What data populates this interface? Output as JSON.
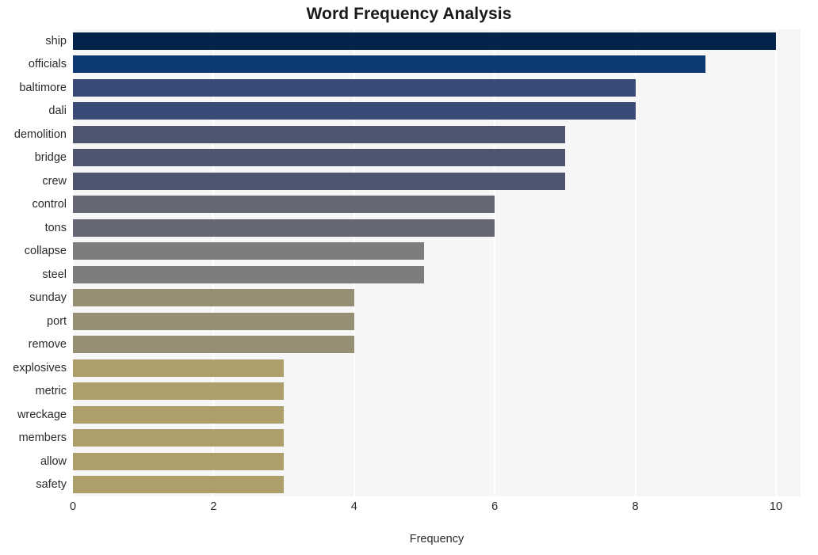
{
  "chart_data": {
    "type": "bar",
    "orientation": "horizontal",
    "title": "Word Frequency Analysis",
    "xlabel": "Frequency",
    "ylabel": "",
    "xlim": [
      0,
      10.35
    ],
    "xticks": [
      0,
      2,
      4,
      6,
      8,
      10
    ],
    "xtick_labels": [
      "0",
      "2",
      "4",
      "6",
      "8",
      "10"
    ],
    "grid": "vertical-only",
    "legend": "none",
    "categories": [
      "ship",
      "officials",
      "baltimore",
      "dali",
      "demolition",
      "bridge",
      "crew",
      "control",
      "tons",
      "collapse",
      "steel",
      "sunday",
      "port",
      "remove",
      "explosives",
      "metric",
      "wreckage",
      "members",
      "allow",
      "safety"
    ],
    "values": [
      10,
      9,
      8,
      8,
      7,
      7,
      7,
      6,
      6,
      5,
      5,
      4,
      4,
      4,
      3,
      3,
      3,
      3,
      3,
      3
    ],
    "bar_colors": [
      "#03234b",
      "#0c3873",
      "#394a77",
      "#394a77",
      "#4d566e",
      "#4d566e",
      "#4d566e",
      "#656874",
      "#656874",
      "#7d7d7d",
      "#7d7d7d",
      "#978f74",
      "#978f74",
      "#978f74",
      "#ad9f6b",
      "#ad9f6b",
      "#ad9f6b",
      "#ad9f6b",
      "#ad9f6b",
      "#ad9f6b"
    ],
    "plot_background": "#f6f6f7",
    "figure_background": "#ffffff",
    "gridline_color": "#ffffff",
    "text_color": "#2b2b2b",
    "title_color": "#1a1a1a"
  }
}
